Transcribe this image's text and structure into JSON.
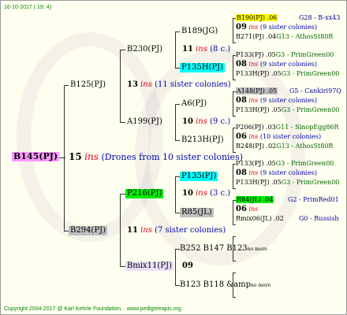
{
  "header": {
    "date": "16-10-2017 ( 19: 4)"
  },
  "footer": {
    "copyright": "Copyright 2004-2017 @ Karl Kehrle Foundation.",
    "website": "www.pedigreeapis.org"
  },
  "colors": {
    "magenta": "#ff99ff",
    "yellow": "#ffff00",
    "cyan": "#00ffff",
    "green": "#00ee00",
    "gray": "#c0c0c0",
    "lightgray": "#e8e8e8",
    "lavender": "#e8e0f8"
  },
  "root": {
    "name": "B145(PJ)",
    "gen": "15",
    "ins": "ins",
    "note": "(Drones from 10 sister colonies)"
  },
  "g1": [
    {
      "name": "B125(PJ)",
      "gen": "13",
      "ins": "ins",
      "note": "(11 sister colonies)"
    },
    {
      "name": "B294(PJ)",
      "gen": "11",
      "ins": "ins",
      "note": "(7 sister colonies)"
    }
  ],
  "g2": [
    {
      "name": "B230(PJ)",
      "gen": "11",
      "ins": "ins",
      "note": "(8 c.)"
    },
    {
      "name": "A199(PJ)",
      "gen": "10",
      "ins": "ins",
      "note": "(9 c.)"
    },
    {
      "name": "P216(PJ)",
      "gen": "10",
      "ins": "ins",
      "note": "(3 c.)"
    },
    {
      "name": "Bmix11(PJ)",
      "gen": "09"
    }
  ],
  "g3": [
    {
      "name": "B189(JG)"
    },
    {
      "name": "P135H(PJ)"
    },
    {
      "name": "A6(PJ)"
    },
    {
      "name": "B213H(PJ)"
    },
    {
      "name": "P135(PJ)"
    },
    {
      "name": "R85(JL)"
    },
    {
      "name": "B252 B147 B123",
      "suffix": "no more"
    },
    {
      "name": "B123 B118 &amp",
      "suffix": "no more"
    }
  ],
  "g4": [
    {
      "top": "B190(PJ) .06",
      "topinfo": "G28 - B-xx43",
      "gen": "09",
      "ins": "ins",
      "note": "(9 sister colonies)",
      "bottom": "B271(PJ) .04",
      "bottominfo": "G13 - AthosSt80R"
    },
    {
      "top": "P133(PJ) .05",
      "topinfo": "G3 - PrimGreen00",
      "gen": "08",
      "ins": "ins",
      "note": "(9 sister colonies)",
      "bottom": "P133H(PJ) .05",
      "bottominfo": "G3 - PrimGreen00"
    },
    {
      "top": "A148(PJ) .05",
      "topinfo": "G5 - Cankiri97Q",
      "gen": "08",
      "ins": "ins",
      "note": "(9 sister colonies)",
      "bottom": "P133H(PJ) .05",
      "bottominfo": "G3 - PrimGreen00"
    },
    {
      "top": "P206(PJ) .03",
      "topinfo": "G11 - SinopEgg86R",
      "gen": "06",
      "ins": "ins",
      "note": "(10 sister colonies)",
      "bottom": "B248(PJ) .02",
      "bottominfo": "G13 - AthosSt80R"
    },
    {
      "top": "P133(PJ) .05",
      "topinfo": "G3 - PrimGreen00",
      "gen": "08",
      "ins": "ins",
      "note": "(9 sister colonies)",
      "bottom": "P133H(PJ) .05",
      "bottominfo": "G3 - PrimGreen00"
    },
    {
      "top": "R84(JL) .04",
      "topinfo": "G2 - PrimRed01",
      "gen": "06",
      "ins": "ins",
      "note": "",
      "bottom": "Rmix06(JL) .02",
      "bottominfo": "G0 - Russish"
    }
  ]
}
